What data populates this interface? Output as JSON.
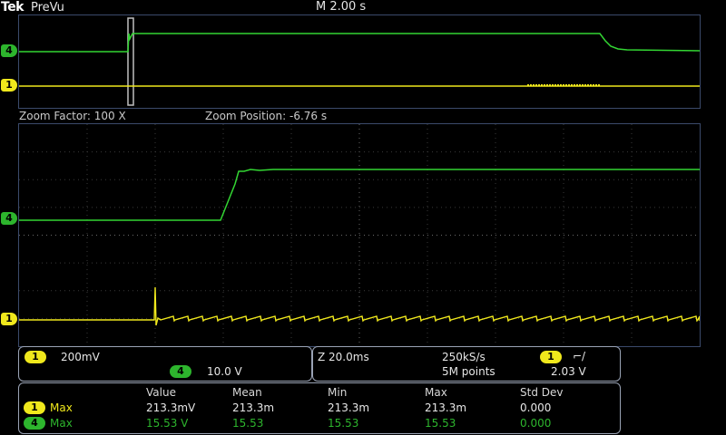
{
  "header": {
    "brand": "Tek",
    "mode": "PreVu",
    "timebase": "M 2.00 s"
  },
  "zoom": {
    "factor_label": "Zoom Factor: 100 X",
    "position_label": "Zoom Position: -6.76 s"
  },
  "channels": {
    "ch1": {
      "number": "1",
      "color": "#f0e81c",
      "scale": "200mV"
    },
    "ch4": {
      "number": "4",
      "color": "#2db52d",
      "scale": "10.0 V"
    }
  },
  "acquisition": {
    "zoom_timebase": "Z 20.0ms",
    "sample_rate": "250kS/s",
    "record_length": "5M points",
    "trigger_channel": "1",
    "trigger_slope_icon": "rising-edge-icon",
    "trigger_slope_glyph": "⌐/",
    "trigger_level": "2.03 V"
  },
  "measurements": {
    "headers": [
      "Value",
      "Mean",
      "Min",
      "Max",
      "Std Dev"
    ],
    "rows": [
      {
        "channel": "1",
        "type": "Max",
        "value": "213.3mV",
        "mean": "213.3m",
        "min": "213.3m",
        "max": "213.3m",
        "std_dev": "0.000"
      },
      {
        "channel": "4",
        "type": "Max",
        "value": "15.53 V",
        "mean": "15.53",
        "min": "15.53",
        "max": "15.53",
        "std_dev": "0.000"
      }
    ]
  }
}
